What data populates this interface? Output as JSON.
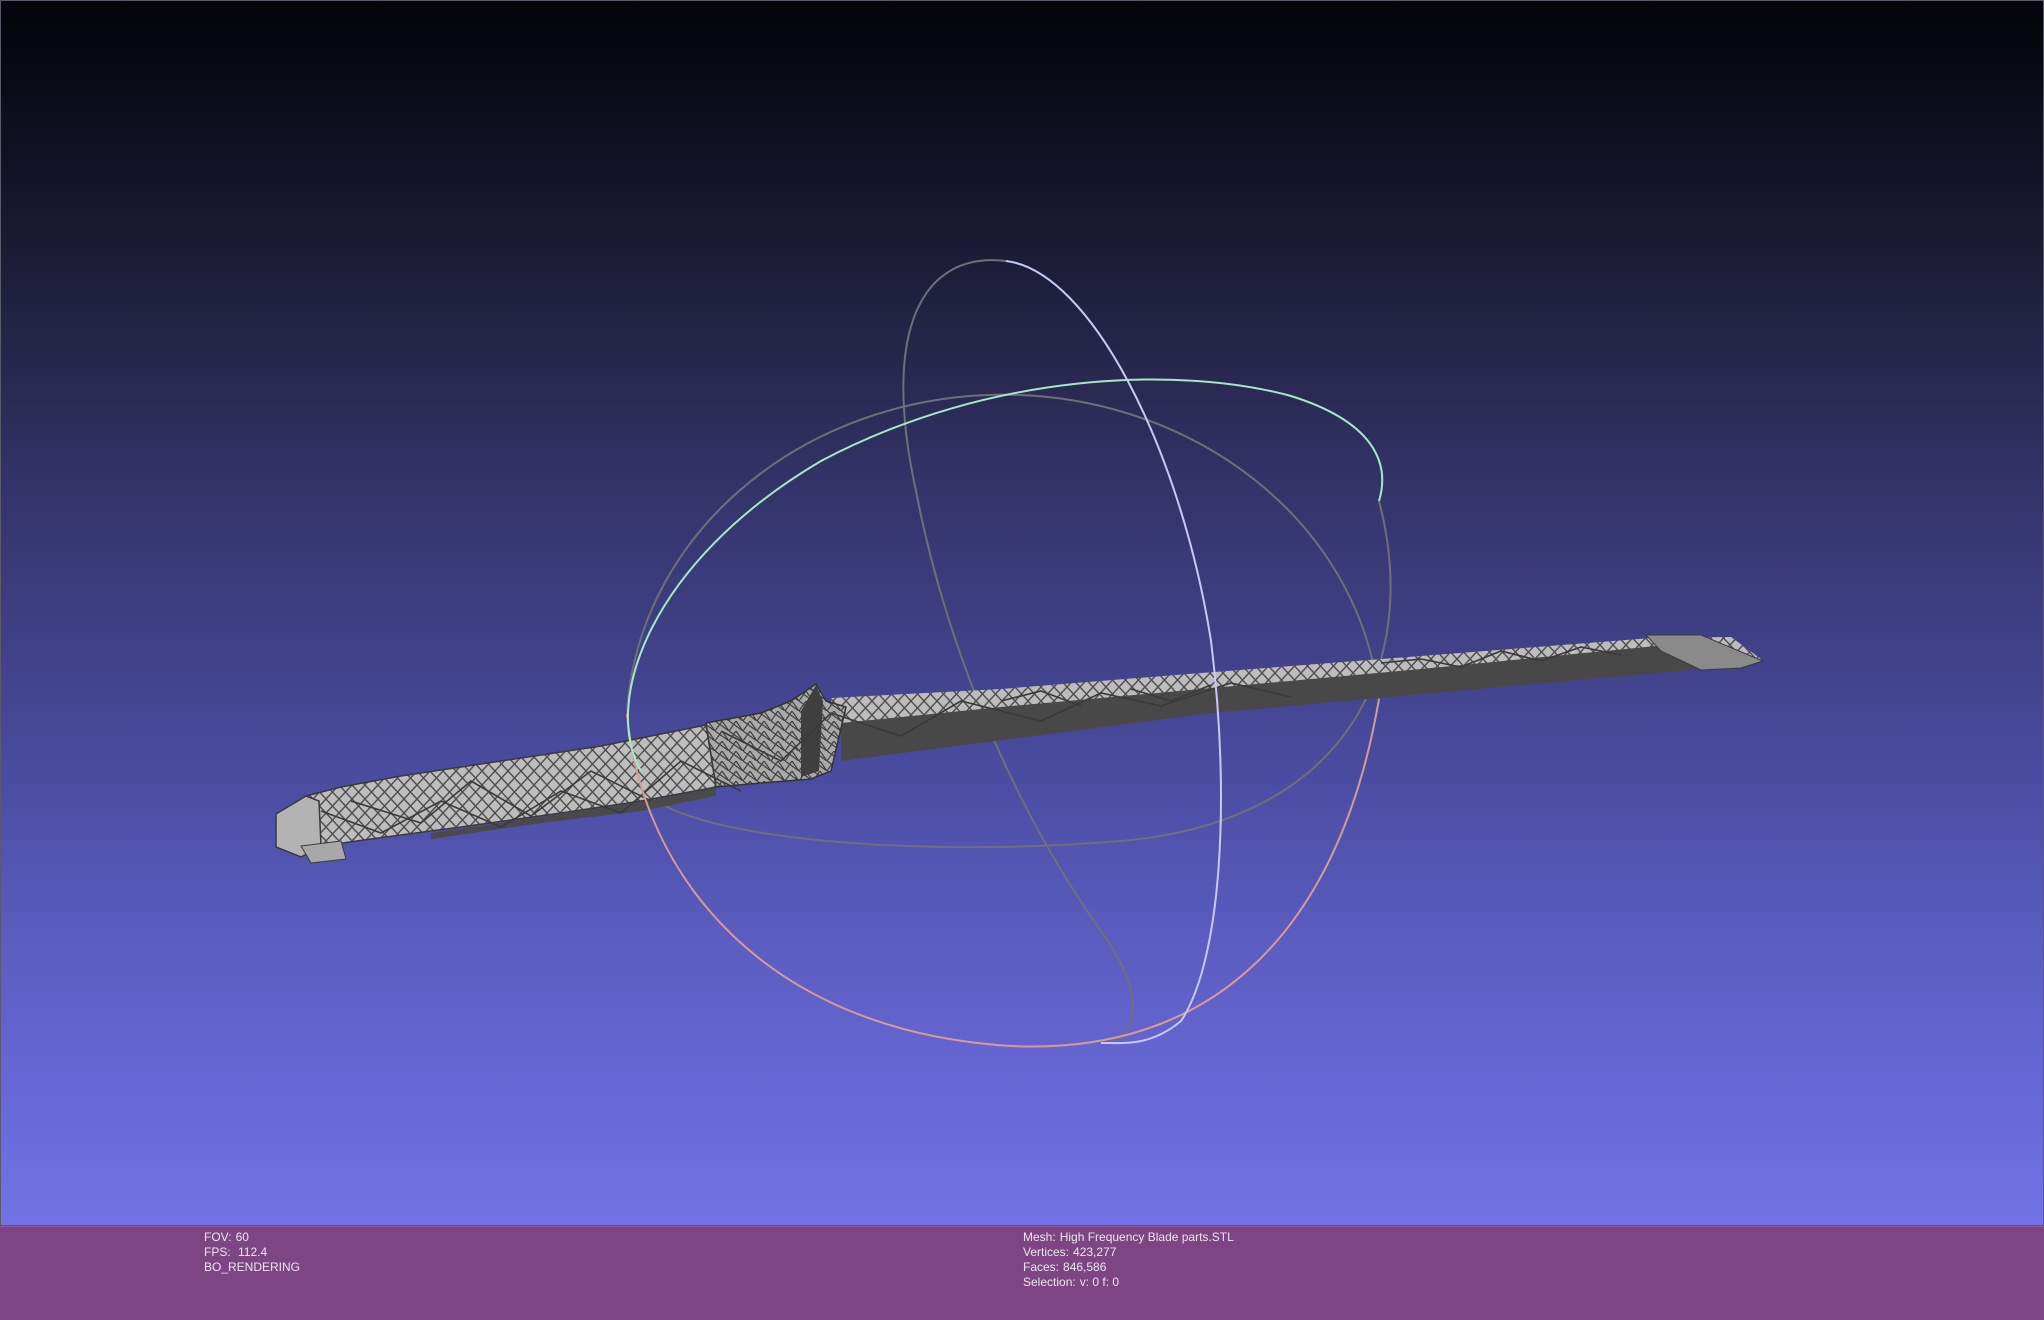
{
  "info": {
    "fov_label": "FOV:",
    "fov_value": "60",
    "fps_label": "FPS:",
    "fps_value": "112.4",
    "render_mode": "BO_RENDERING",
    "mesh_label": "Mesh:",
    "mesh_name": "High Frequency Blade parts.STL",
    "vertices_label": "Vertices:",
    "vertices_value": "423,277",
    "faces_label": "Faces:",
    "faces_value": "846,586",
    "selection_label": "Selection:",
    "selection_value": "v: 0 f: 0"
  },
  "colors": {
    "background_top": "#030308",
    "background_bottom": "#7273e6",
    "info_bar": "#7d4584",
    "info_text": "#ece6ee",
    "mesh_fill": "#b9b9b9",
    "mesh_dark": "#4a4a4a",
    "trackball_x": "#d89a96",
    "trackball_y": "#a8e6c8",
    "trackball_z": "#c8c8f4",
    "trackball_back": "#6f6f78"
  },
  "icons": {
    "trackball": "trackball-icon",
    "mesh": "blade-mesh"
  }
}
